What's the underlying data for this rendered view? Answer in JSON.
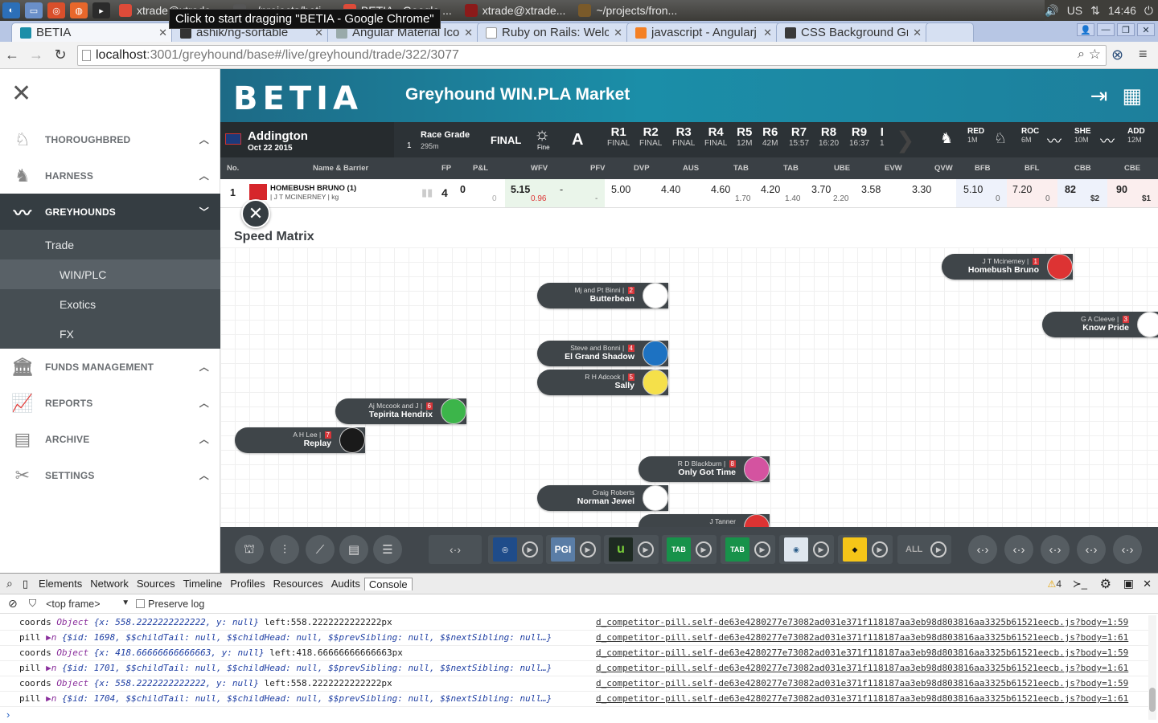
{
  "os": {
    "taskbar": [
      {
        "label": "xtrade@xtrade..."
      },
      {
        "label": "~/projects/beti..."
      },
      {
        "label": "BETIA - Google ..."
      },
      {
        "label": "xtrade@xtrade..."
      },
      {
        "label": "~/projects/fron..."
      }
    ],
    "tooltip": "Click to start dragging \"BETIA - Google Chrome\"",
    "lang": "US",
    "time": "14:46"
  },
  "browser": {
    "tabs": [
      {
        "title": "BETIA",
        "active": true
      },
      {
        "title": "ashik/ng-sortable"
      },
      {
        "title": "Angular Material Ico"
      },
      {
        "title": "Ruby on Rails: Welco"
      },
      {
        "title": "javascript - Angularj"
      },
      {
        "title": "CSS Background Gri"
      }
    ],
    "url_host": "localhost",
    "url_rest": ":3001/greyhound/base#/live/greyhound/trade/322/3077"
  },
  "sidebar": {
    "items": [
      {
        "label": "THOROUGHBRED"
      },
      {
        "label": "HARNESS"
      },
      {
        "label": "GREYHOUNDS"
      },
      {
        "label": "FUNDS MANAGEMENT"
      },
      {
        "label": "REPORTS"
      },
      {
        "label": "ARCHIVE"
      },
      {
        "label": "SETTINGS"
      }
    ],
    "sub": [
      {
        "label": "Trade"
      },
      {
        "label": "WIN/PLC"
      },
      {
        "label": "Exotics"
      },
      {
        "label": "FX"
      }
    ]
  },
  "header": {
    "logo": "BETIA",
    "market_title": "Greyhound WIN.PLA Market"
  },
  "race": {
    "venue": "Addington",
    "date": "Oct 22 2015",
    "race_no": "1",
    "grade_label": "Race Grade",
    "distance": "295m",
    "status": "FINAL",
    "weather": "Fine",
    "track": "A",
    "races": [
      {
        "r": "R1",
        "s": "FINAL"
      },
      {
        "r": "R2",
        "s": "FINAL"
      },
      {
        "r": "R3",
        "s": "FINAL"
      },
      {
        "r": "R4",
        "s": "FINAL"
      },
      {
        "r": "R5",
        "s": "12M"
      },
      {
        "r": "R6",
        "s": "42M"
      },
      {
        "r": "R7",
        "s": "15:57"
      },
      {
        "r": "R8",
        "s": "16:20"
      },
      {
        "r": "R9",
        "s": "16:37"
      },
      {
        "r": "I",
        "s": "1"
      }
    ],
    "shortcuts": [
      {
        "code": "RED",
        "t": "1M"
      },
      {
        "code": "ROC",
        "t": "6M"
      },
      {
        "code": "SHE",
        "t": "10M"
      },
      {
        "code": "ADD",
        "t": "12M"
      }
    ]
  },
  "columns": [
    "No.",
    "Name & Barrier",
    "FP",
    "P&L",
    "WFV",
    "PFV",
    "DVP",
    "AUS",
    "TAB",
    "TAB",
    "UBE",
    "EVW",
    "QVW",
    "BFB",
    "BFL",
    "CBB",
    "CBE"
  ],
  "runner": {
    "no": "1",
    "name": "HOMEBUSH BRUNO (1)",
    "sub": "| J T MCINERNEY | kg",
    "fp": "4",
    "pl": "0",
    "pl_sub": "0",
    "wfv": "5.15",
    "wfv_sub": "0.96",
    "pfv": "-",
    "pfv_sub": "-",
    "dvp": "5.00",
    "aus": "4.40",
    "tab1": "4.60",
    "tab1_sub": "1.70",
    "tab2": "4.20",
    "tab2_sub": "1.40",
    "ube": "3.70",
    "ube_sub": "2.20",
    "evw": "3.58",
    "qvw": "3.30",
    "bfb": "5.10",
    "bfb_sub": "0",
    "bfl": "7.20",
    "bfl_sub": "0",
    "cbb": "82",
    "cbb_sub": "$2",
    "cbe": "90",
    "cbe_sub": "$1"
  },
  "speed_matrix": {
    "title": "Speed Matrix",
    "pills": [
      {
        "trainer": "J T Mcinerney",
        "box": "1",
        "dog": "Homebush Bruno",
        "color": "#dd3333"
      },
      {
        "trainer": "Mj and Pt Binni",
        "box": "2",
        "dog": "Butterbean",
        "color": "#ffffff"
      },
      {
        "trainer": "G A Cleeve",
        "box": "3",
        "dog": "Know Pride",
        "color": "#ffffff"
      },
      {
        "trainer": "Steve and Bonni",
        "box": "4",
        "dog": "El Grand Shadow",
        "color": "#1d72c2"
      },
      {
        "trainer": "R H Adcock",
        "box": "5",
        "dog": "Sally",
        "color": "#f5e04a"
      },
      {
        "trainer": "Aj Mccook and J",
        "box": "6",
        "dog": "Tepirita Hendrix",
        "color": "#3cb54a"
      },
      {
        "trainer": "A H Lee",
        "box": "7",
        "dog": "Replay",
        "color": "#1a1a1a"
      },
      {
        "trainer": "R D Blackburn",
        "box": "8",
        "dog": "Only Got Time",
        "color": "#d453a0"
      },
      {
        "trainer": "Craig Roberts",
        "box": "",
        "dog": "Norman Jewel",
        "color": "#ffffff"
      },
      {
        "trainer": "J Tanner",
        "box": "",
        "dog": "",
        "color": "#dd3333"
      }
    ]
  },
  "dock": {
    "all_label": "ALL",
    "pgi": "PGI"
  },
  "devtools": {
    "tabs": [
      "Elements",
      "Network",
      "Sources",
      "Timeline",
      "Profiles",
      "Resources",
      "Audits",
      "Console"
    ],
    "warnings": "4",
    "frame": "<top frame>",
    "preserve": "Preserve log",
    "src_a": "d_competitor-pill.self-de63e4280277e73082ad031e371f118187aa3eb98d803816aa3325b61521eecb.js?body=1:59",
    "src_b": "d_competitor-pill.self-de63e4280277e73082ad031e371f118187aa3eb98d803816aa3325b61521eecb.js?body=1:61",
    "lines": [
      {
        "a": "coords ",
        "b": "Object ",
        "c": "{x: 558.2222222222222, y: null}",
        "d": " left:558.2222222222222px"
      },
      {
        "a": "pill ",
        "b": "▶n ",
        "c": "{$id: 1698, $$childTail: null, $$childHead: null, $$prevSibling: null, $$nextSibling: null…}",
        "d": ""
      },
      {
        "a": "coords ",
        "b": "Object ",
        "c": "{x: 418.66666666666663, y: null}",
        "d": " left:418.66666666666663px"
      },
      {
        "a": "pill ",
        "b": "▶n ",
        "c": "{$id: 1701, $$childTail: null, $$childHead: null, $$prevSibling: null, $$nextSibling: null…}",
        "d": ""
      },
      {
        "a": "coords ",
        "b": "Object ",
        "c": "{x: 558.2222222222222, y: null}",
        "d": " left:558.2222222222222px"
      },
      {
        "a": "pill ",
        "b": "▶n ",
        "c": "{$id: 1704, $$childTail: null, $$childHead: null, $$prevSibling: null, $$nextSibling: null…}",
        "d": ""
      }
    ]
  }
}
